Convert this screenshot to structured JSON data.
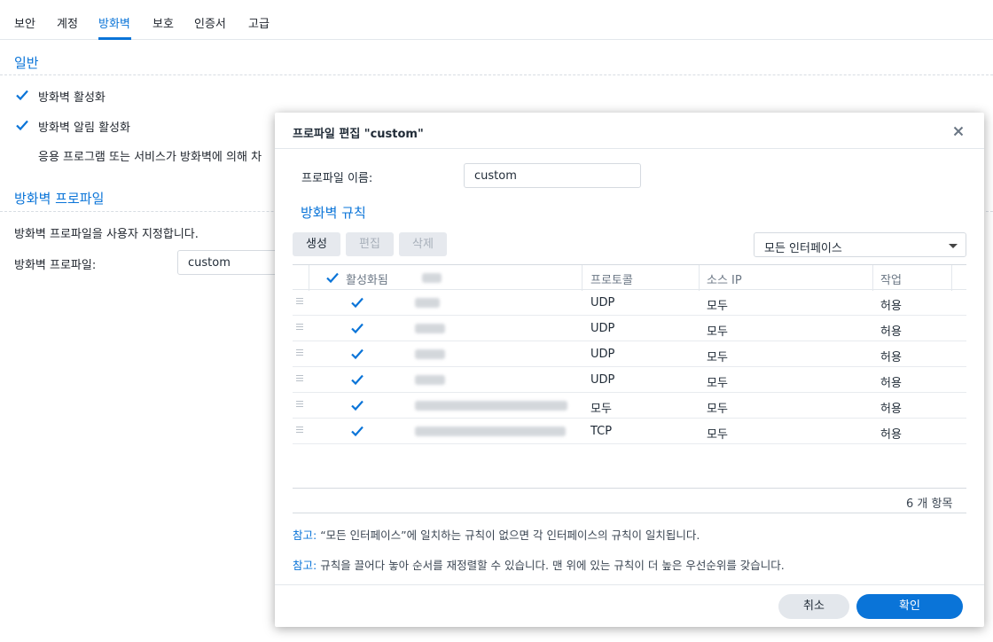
{
  "tabs": [
    "보안",
    "계정",
    "방화벽",
    "보호",
    "인증서",
    "고급"
  ],
  "active_tab": "방화벽",
  "general": {
    "title": "일반",
    "enable_firewall": "방화벽 활성화",
    "enable_notify": "방화벽 알림 활성화",
    "notify_desc": "응용 프로그램 또는 서비스가 방화벽에 의해 차"
  },
  "profile_section": {
    "title": "방화벽 프로파일",
    "desc": "방화벽 프로파일을 사용자 지정합니다.",
    "label": "방화벽 프로파일:",
    "value": "custom"
  },
  "dialog": {
    "title": "프로파일 편집 \"custom\"",
    "name_label": "프로파일 이름:",
    "name_value": "custom",
    "rules_title": "방화벽 규칙",
    "btn_create": "생성",
    "btn_edit": "편집",
    "btn_delete": "삭제",
    "interface_select": "모든 인터페이스",
    "columns": {
      "enabled": "활성화됨",
      "protocol": "프로토콜",
      "source_ip": "소스 IP",
      "action": "작업"
    },
    "rows": [
      {
        "protocol": "UDP",
        "source": "모두",
        "action": "허용"
      },
      {
        "protocol": "UDP",
        "source": "모두",
        "action": "허용"
      },
      {
        "protocol": "UDP",
        "source": "모두",
        "action": "허용"
      },
      {
        "protocol": "UDP",
        "source": "모두",
        "action": "허용"
      },
      {
        "protocol": "모두",
        "source": "모두",
        "action": "허용"
      },
      {
        "protocol": "TCP",
        "source": "모두",
        "action": "허용"
      }
    ],
    "item_count": "6 개 항목",
    "note1_ref": "참고:",
    "note1_text": " “모든 인터페이스”에 일치하는 규칙이 없으면 각 인터페이스의 규칙이 일치됩니다.",
    "note2_ref": "참고:",
    "note2_text": " 규칙을 끌어다 놓아 순서를 재정렬할 수 있습니다. 맨 위에 있는 규칙이 더 높은 우선순위를 갖습니다.",
    "cancel": "취소",
    "ok": "확인"
  },
  "colors": {
    "accent": "#0a74d8"
  }
}
